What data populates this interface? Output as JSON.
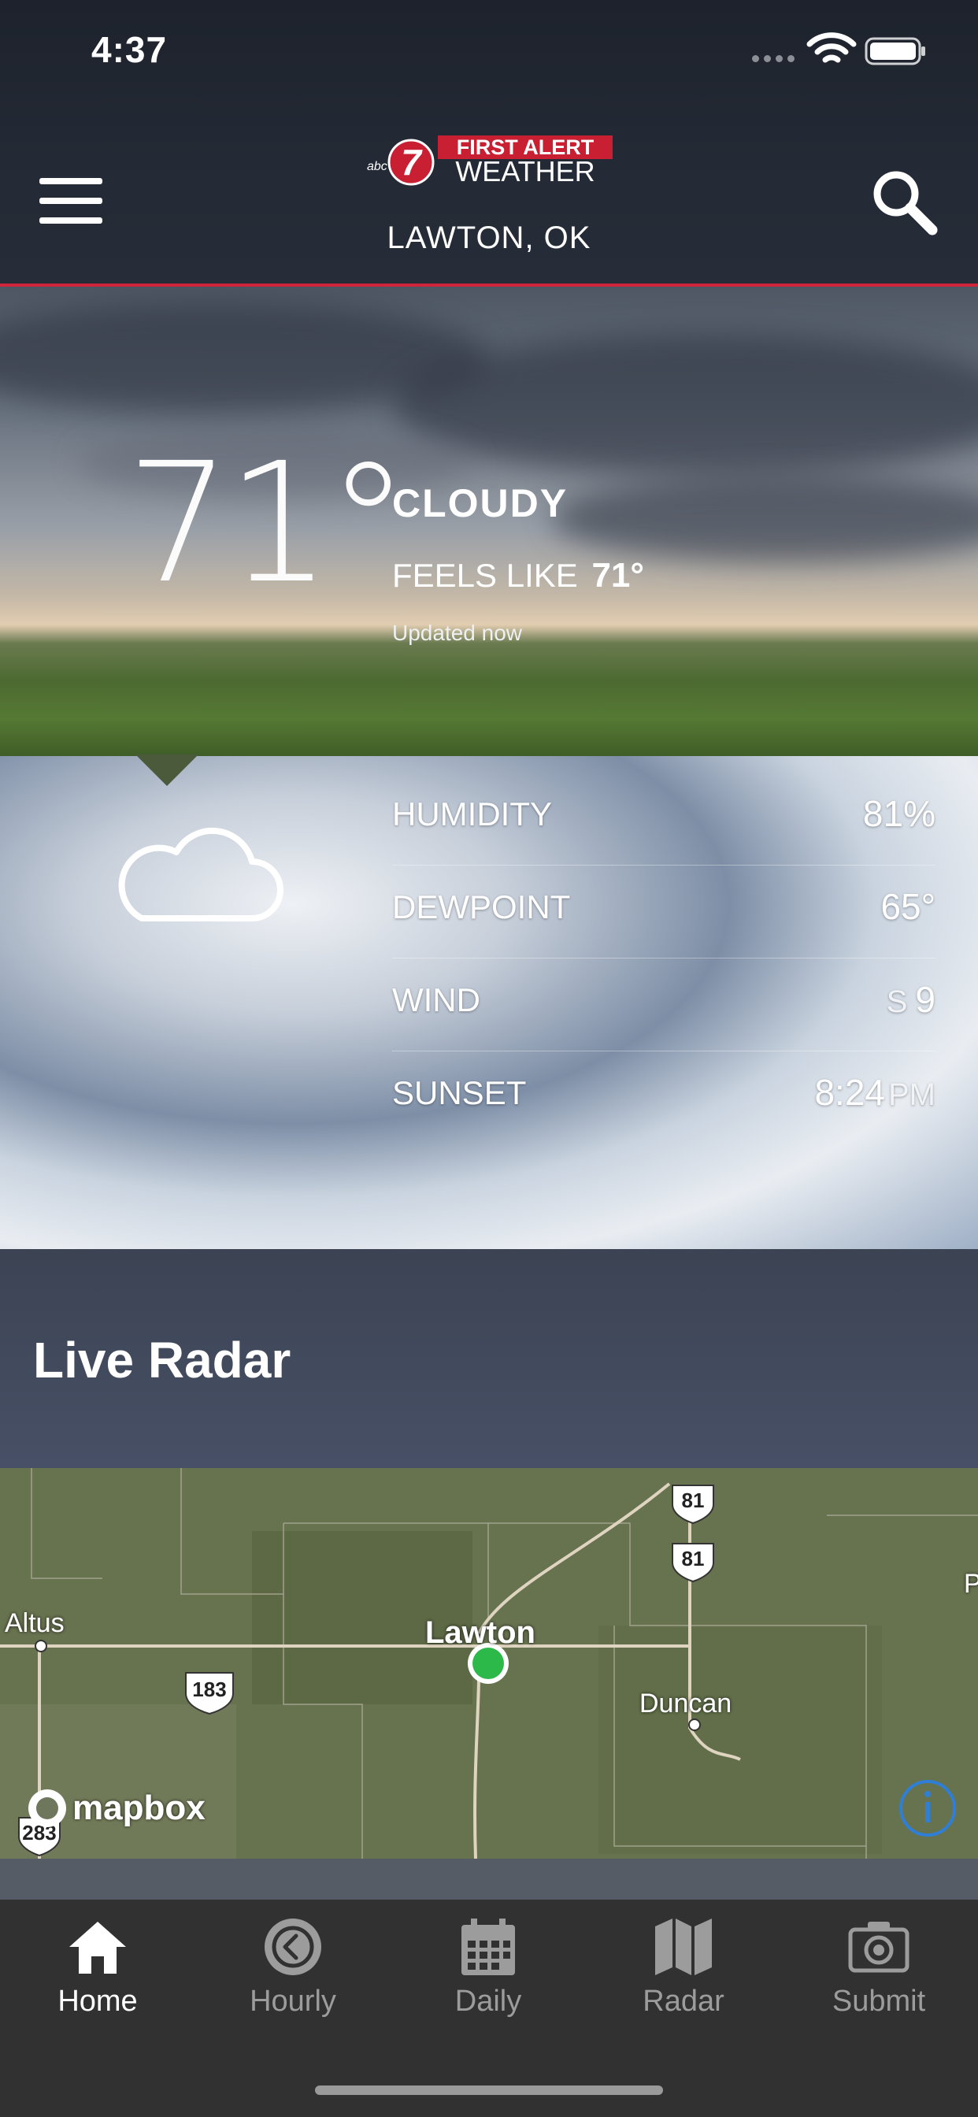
{
  "status_bar": {
    "time": "4:37"
  },
  "header": {
    "brand_badge": "7",
    "brand_network": "abc",
    "brand_line1": "FIRST ALERT",
    "brand_line2": "WEATHER",
    "location": "LAWTON, OK"
  },
  "current": {
    "temperature": "71°",
    "condition": "CLOUDY",
    "feels_like_label": "FEELS LIKE",
    "feels_like_value": "71°",
    "updated": "Updated now",
    "icon": "cloud-icon"
  },
  "details": [
    {
      "label": "HUMIDITY",
      "value": "81%",
      "prefix": "",
      "unit": ""
    },
    {
      "label": "DEWPOINT",
      "value": "65°",
      "prefix": "",
      "unit": ""
    },
    {
      "label": "WIND",
      "value": "9",
      "prefix": "S",
      "unit": ""
    },
    {
      "label": "SUNSET",
      "value": "8:24",
      "prefix": "",
      "unit": "PM"
    }
  ],
  "radar": {
    "title": "Live Radar",
    "attribution": "mapbox",
    "places": {
      "altus": "Altus",
      "lawton": "Lawton",
      "duncan": "Duncan",
      "edge": "P"
    },
    "shields": {
      "us183": "183",
      "us81a": "81",
      "us81b": "81",
      "sh283": "283"
    }
  },
  "tabs": [
    {
      "label": "Home",
      "icon": "home-icon",
      "active": true
    },
    {
      "label": "Hourly",
      "icon": "clock-icon",
      "active": false
    },
    {
      "label": "Daily",
      "icon": "calendar-icon",
      "active": false
    },
    {
      "label": "Radar",
      "icon": "map-icon",
      "active": false
    },
    {
      "label": "Submit",
      "icon": "camera-icon",
      "active": false
    }
  ],
  "colors": {
    "accent_red": "#d0243a",
    "location_dot": "#2db84a",
    "tab_active": "#ffffff",
    "tab_inactive": "#9c9c9c"
  }
}
